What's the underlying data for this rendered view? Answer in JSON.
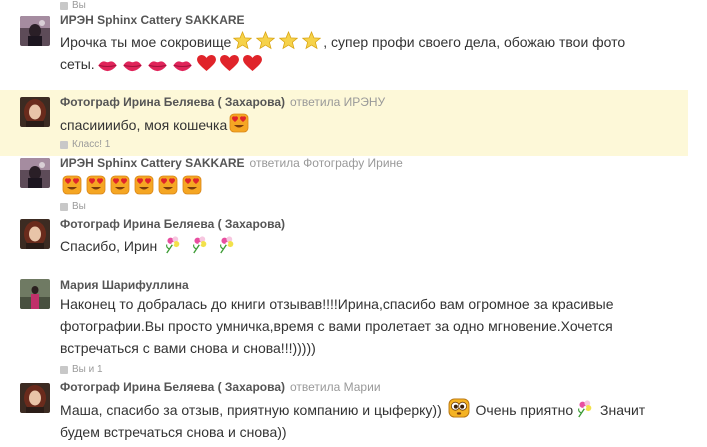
{
  "comments": [
    {
      "top_like": "Вы",
      "author": "ИРЭН Sphinx Cattery SAKKARE",
      "text1": "Ирочка ты мое сокровище",
      "text2": ", супер профи своего дела, обожаю твои фото",
      "text3": "сеты."
    },
    {
      "author": "Фотограф Ирина Беляева ( Захарова)",
      "reply": "ответила ИРЭНУ",
      "text": "спасиииибо, моя кошечка",
      "likes": "Класс! 1"
    },
    {
      "author": "ИРЭН Sphinx Cattery SAKKARE",
      "reply": "ответила Фотографу Ирине",
      "likes": "Вы"
    },
    {
      "author": "Фотограф Ирина Беляева ( Захарова)",
      "text": "Спасибо, Ирин"
    },
    {
      "author": "Мария Шарифуллина",
      "lines": [
        "Наконец то добралась до книги отзывав!!!!Ирина,спасибо вам огромное за красивые",
        "фотографии.Вы просто умничка,время с вами пролетает за одно мгновение.Хочется",
        "встречаться с вами снова и снова!!!)))))"
      ],
      "likes": "Вы и 1"
    },
    {
      "author": "Фотограф Ирина Беляева ( Захарова)",
      "reply": "ответила Марии",
      "text1": "Маша, спасибо за отзыв, приятную компанию и цыферку))",
      "text2": "Очень приятно",
      "text3": "Значит",
      "text4": "будем встречаться снова и снова))"
    }
  ],
  "icons": [
    "like-thumb-icon",
    "star-emoji-icon",
    "lips-emoji-icon",
    "heart-emoji-icon",
    "heart-eyes-emoji-icon",
    "flower-emoji-icon",
    "big-eyes-emoji-icon"
  ],
  "colors": {
    "highlight": "#fdf8d8",
    "author": "#555555",
    "meta": "#999999",
    "heart": "#e0242a",
    "star": "#f5c518"
  }
}
